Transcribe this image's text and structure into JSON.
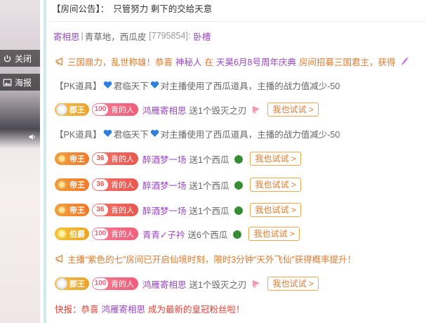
{
  "video": {
    "close_label": "关闭",
    "report_label": "海报"
  },
  "announcement": {
    "prefix": "【房间公告】：",
    "text": "只管努力 剩下的交给天意"
  },
  "anchor_info": {
    "name": "寄相思",
    "separator": "|",
    "tags": "青草地，西瓜皮",
    "room_id": "[7795854]",
    "colon": ":",
    "status": "卧槽"
  },
  "broadcast_1": {
    "part1": "三国鼎力，乱世称雄！恭喜",
    "who": "神秘人",
    "part2": "在",
    "event": "天昊6月8号周年庆典",
    "part3": "房间招募三国君主，获得"
  },
  "pk_1": {
    "prefix": "【PK道具】",
    "user": "君临天下",
    "text": "对主播使用了西瓜道具，主播的战力值减少-50"
  },
  "gift_1": {
    "rank": "郡王",
    "fan_level": "100",
    "fan_name": "青的人",
    "user": "鸿雁寄相思",
    "text": "送1个毁灭之刃",
    "try": "我也试试 >"
  },
  "pk_2": {
    "prefix": "【PK道具】",
    "user": "君临天下",
    "text": "对主播使用了西瓜道具，主播的战力值减少-50"
  },
  "gift_2": {
    "rank": "帝王",
    "fan_level": "36",
    "fan_name": "青的人",
    "user": "醉酒梦一场",
    "text": "送1个西瓜",
    "try": "我也试试 >"
  },
  "gift_3": {
    "rank": "帝王",
    "fan_level": "36",
    "fan_name": "青的人",
    "user": "醉酒梦一场",
    "text": "送1个西瓜",
    "try": "我也试试 >"
  },
  "gift_4": {
    "rank": "帝王",
    "fan_level": "36",
    "fan_name": "青的人",
    "user": "醉酒梦一场",
    "text": "送1个西瓜",
    "try": "我也试试 >"
  },
  "gift_5": {
    "rank": "伯爵",
    "fan_level": "100",
    "fan_name": "青的人",
    "user": "青青✓子衿",
    "text": "送6个西瓜",
    "try": "我也试试 >"
  },
  "notice": {
    "text": "主播“紫色的七”房间已开启仙境时刻，限时3分钟“天外飞仙”获得概率提升！"
  },
  "gift_6": {
    "rank": "郡王",
    "fan_level": "100",
    "fan_name": "青的人",
    "user": "鸿雁寄相思",
    "text": "送1个毁灭之刃",
    "try": "我也试试 >"
  },
  "news": {
    "prefix": "快报：恭喜",
    "user": "鸿雁寄相思",
    "suffix": "成为最新的皇冠粉丝啦！"
  },
  "colors": {
    "user_purple": "#9b46c8",
    "accent_orange": "#e07a2e",
    "fan_red": "#e8584f",
    "heart_blue": "#2b7de0"
  }
}
